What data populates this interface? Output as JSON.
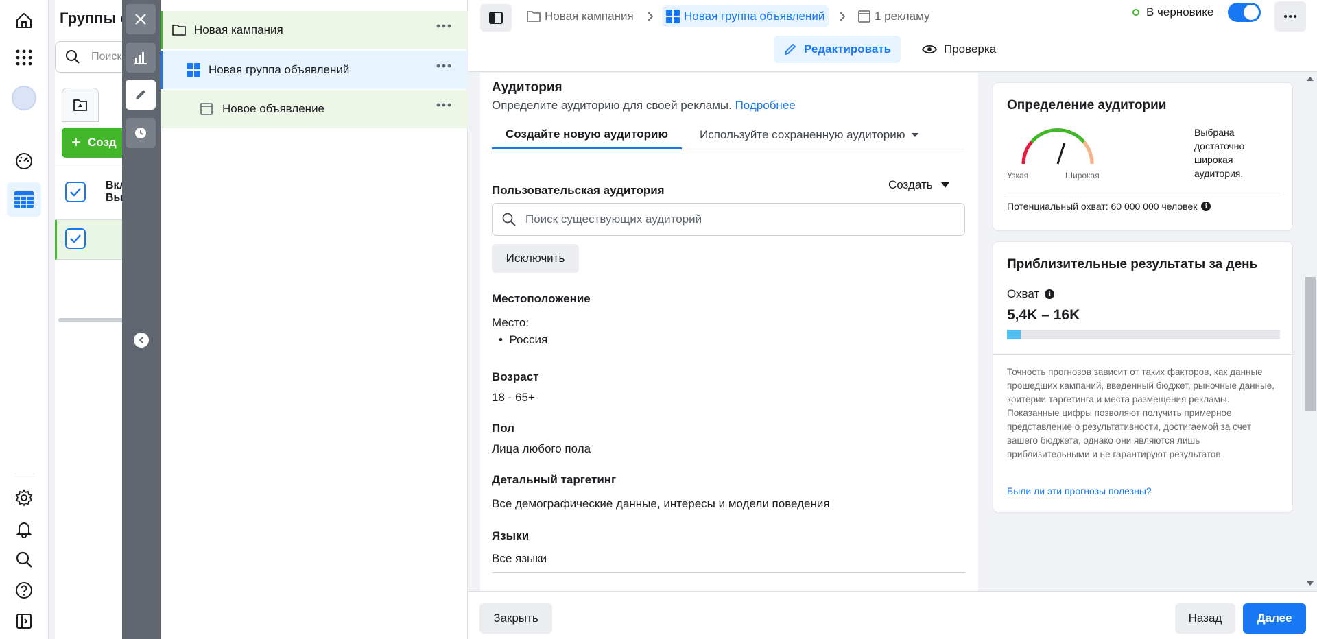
{
  "background_manager": {
    "title": "Группы о",
    "search_placeholder": "Поиск",
    "create_label": "Созд",
    "column_header_line1": "Вкл",
    "column_header_line2": "Вы"
  },
  "tree": {
    "campaign": "Новая кампания",
    "adset": "Новая группа объявлений",
    "ad": "Новое объявление"
  },
  "breadcrumb": {
    "campaign": "Новая кампания",
    "adset": "Новая группа объявлений",
    "ads": "1 рекламу"
  },
  "status": {
    "label": "В черновике",
    "toggle_on": true
  },
  "mode": {
    "edit": "Редактировать",
    "review": "Проверка"
  },
  "audience": {
    "title": "Аудитория",
    "subtitle": "Определите аудиторию для своей рекламы.",
    "learn_more": "Подробнее",
    "tab_new": "Создайте новую аудиторию",
    "tab_saved": "Используйте сохраненную аудиторию",
    "custom_audience_label": "Пользовательская аудитория",
    "create_dropdown": "Создать",
    "search_placeholder": "Поиск существующих аудиторий",
    "exclude_button": "Исключить",
    "location_label": "Местоположение",
    "place_label": "Место:",
    "place_value": "Россия",
    "age_label": "Возраст",
    "age_value": "18 - 65+",
    "gender_label": "Пол",
    "gender_value": "Лица любого пола",
    "detailed_label": "Детальный таргетинг",
    "detailed_value": "Все демографические данные, интересы и модели поведения",
    "languages_label": "Языки",
    "languages_value": "Все языки"
  },
  "definition": {
    "title": "Определение аудитории",
    "narrow": "Узкая",
    "broad": "Широкая",
    "description": "Выбрана достаточно широкая аудитория.",
    "potential_reach": "Потенциальный охват: 60 000 000 человек",
    "gauge_level": 0.6
  },
  "estimates": {
    "title": "Приблизительные результаты за день",
    "reach_label": "Охват",
    "reach_value": "5,4K – 16K",
    "reach_fill_fraction": 0.05,
    "disclaimer": "Точность прогнозов зависит от таких факторов, как данные прошедших кампаний, введенный бюджет, рыночные данные, критерии таргетинга и места размещения рекламы. Показанные цифры позволяют получить примерное представление о результативности, достигаемой за счет вашего бюджета, однако они являются лишь приблизительными и не гарантируют результатов.",
    "feedback_link": "Были ли эти прогнозы полезны?"
  },
  "footer": {
    "close": "Закрыть",
    "back": "Назад",
    "next": "Далее"
  },
  "colors": {
    "accent": "#1877f2",
    "green": "#42b72a",
    "reach_bar": "#4ec1f0"
  },
  "icons": [
    "home-icon",
    "apps-grid-icon",
    "avatar",
    "dashboard-gauge-icon",
    "table-icon",
    "settings-icon",
    "bell-icon",
    "search-icon",
    "help-icon",
    "panel-icon",
    "close-icon",
    "chart-icon",
    "pencil-icon",
    "clock-icon",
    "folder-icon",
    "grid-icon",
    "ad-icon",
    "eye-icon",
    "more-icon"
  ]
}
